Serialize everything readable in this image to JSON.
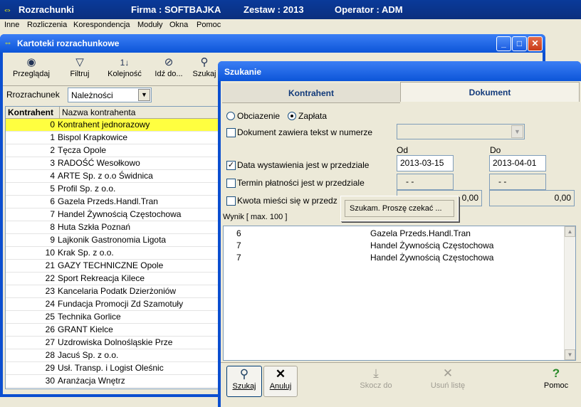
{
  "app": {
    "title": "Rozrachunki",
    "firma": "Firma : SOFTBAJKA",
    "zestaw": "Zestaw : 2013",
    "operator": "Operator : ADM"
  },
  "menu": [
    "Inne",
    "Rozliczenia",
    "Korespondencja",
    "Moduły",
    "Okna",
    "Pomoc"
  ],
  "kartoteki": {
    "title": "Kartoteki rozrachunkowe",
    "toolbar": {
      "przegladaj": "Przeglądaj",
      "filtruj": "Filtruj",
      "kolejnosc": "Kolejność",
      "idz_do": "Idź do...",
      "szukaj": "Szukaj"
    },
    "rozrachunek_label": "Rrozrachunek",
    "rozrachunek_value": "Należności",
    "columns": {
      "kontrahent": "Kontrahent",
      "nazwa": "Nazwa kontrahenta"
    },
    "rows": [
      {
        "id": "0",
        "name": "Kontrahent jednorazowy"
      },
      {
        "id": "1",
        "name": "Bispol Krapkowice"
      },
      {
        "id": "2",
        "name": "Tęcza Opole"
      },
      {
        "id": "3",
        "name": "RADOŚĆ  Wesołkowo"
      },
      {
        "id": "4",
        "name": "ARTE Sp. z o.o Świdnica"
      },
      {
        "id": "5",
        "name": "Profil Sp. z o.o."
      },
      {
        "id": "6",
        "name": "Gazela  Przeds.Handl.Tran"
      },
      {
        "id": "7",
        "name": "Handel Żywnością Częstochowa"
      },
      {
        "id": "8",
        "name": "Huta Szkła Poznań"
      },
      {
        "id": "9",
        "name": "Lajkonik  Gastronomia Ligota"
      },
      {
        "id": "10",
        "name": "Krak Sp. z o.o."
      },
      {
        "id": "21",
        "name": "GAZY TECHNICZNE Opole"
      },
      {
        "id": "22",
        "name": "Sport Rekreacja   Kilece"
      },
      {
        "id": "23",
        "name": "Kancelaria Podatk Dzierżoniów"
      },
      {
        "id": "24",
        "name": "Fundacja Promocji Zd Szamotuły"
      },
      {
        "id": "25",
        "name": "Technika  Gorlice"
      },
      {
        "id": "26",
        "name": "GRANT Kielce"
      },
      {
        "id": "27",
        "name": "Uzdrowiska  Dolnośląskie Prze"
      },
      {
        "id": "28",
        "name": "Jacuś  Sp. z o.o."
      },
      {
        "id": "29",
        "name": "Usł. Transp. i Logist  Oleśnic"
      },
      {
        "id": "30",
        "name": "Aranżacja Wnętrz"
      }
    ]
  },
  "szukanie": {
    "title": "Szukanie",
    "tabs": {
      "kontrahent": "Kontrahent",
      "dokument": "Dokument"
    },
    "radio_obciazenie": "Obciazenie",
    "radio_zaplata": "Zapłata",
    "cb_tekst": "Dokument zawiera tekst w numerze",
    "label_od": "Od",
    "label_do": "Do",
    "cb_data": "Data wystawienia jest w przedziale",
    "data_od": "2013-03-15",
    "data_do": "2013-04-01",
    "cb_termin": "Termin płatności jest w przedziale",
    "termin_od": " - -",
    "termin_do": " - -",
    "cb_kwota": "Kwota mieści się w przedz",
    "kwota_od": "0,00",
    "kwota_do": "0,00",
    "popup": "Szukam. Proszę czekać ...",
    "wynik_label": "Wynik [ max. 100 ]",
    "results": [
      {
        "id": "6",
        "name": "Gazela  Przeds.Handl.Tran"
      },
      {
        "id": "7",
        "name": "Handel Żywnością Częstochowa"
      },
      {
        "id": "7",
        "name": "Handel Żywnością Częstochowa"
      }
    ],
    "buttons": {
      "szukaj": "Szukaj",
      "anuluj": "Anuluj",
      "skocz": "Skocz do",
      "usun": "Usuń listę",
      "pomoc": "Pomoc"
    }
  }
}
